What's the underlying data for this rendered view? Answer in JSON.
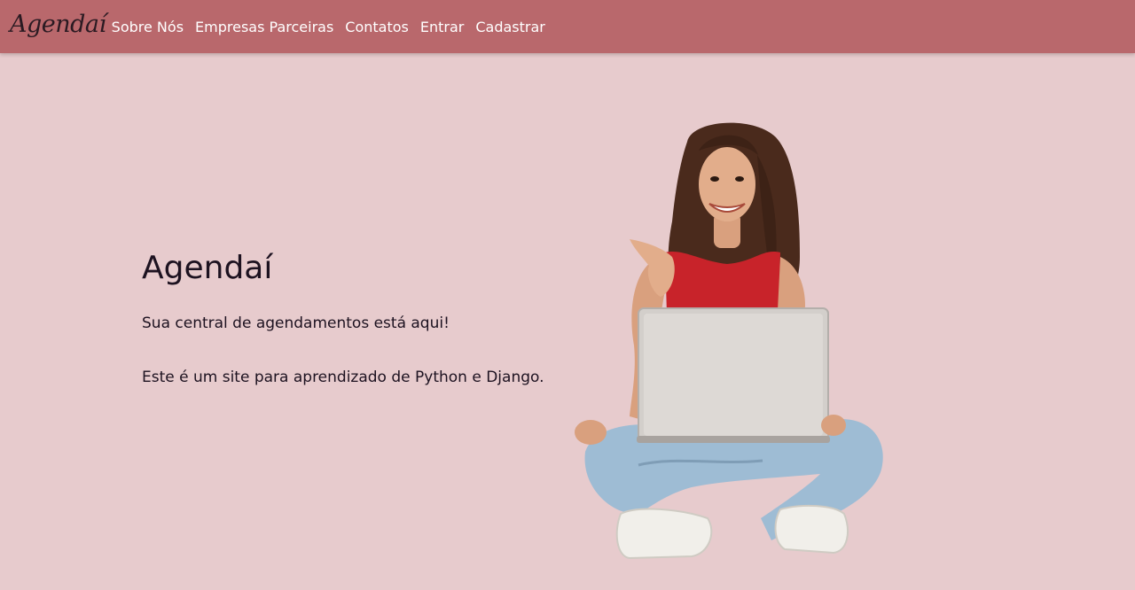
{
  "brand": {
    "logo_text": "Agendaí"
  },
  "nav": {
    "items": [
      {
        "label": "Sobre Nós"
      },
      {
        "label": "Empresas Parceiras"
      },
      {
        "label": "Contatos"
      },
      {
        "label": "Entrar"
      },
      {
        "label": "Cadastrar"
      }
    ]
  },
  "hero": {
    "title": "Agendaí",
    "subtitle": "Sua central de agendamentos está aqui!",
    "description": "Este é um site para aprendizado de Python e Django."
  },
  "colors": {
    "navbar": "#b9686c",
    "background": "#e7cbcd",
    "text": "#1d1220"
  }
}
